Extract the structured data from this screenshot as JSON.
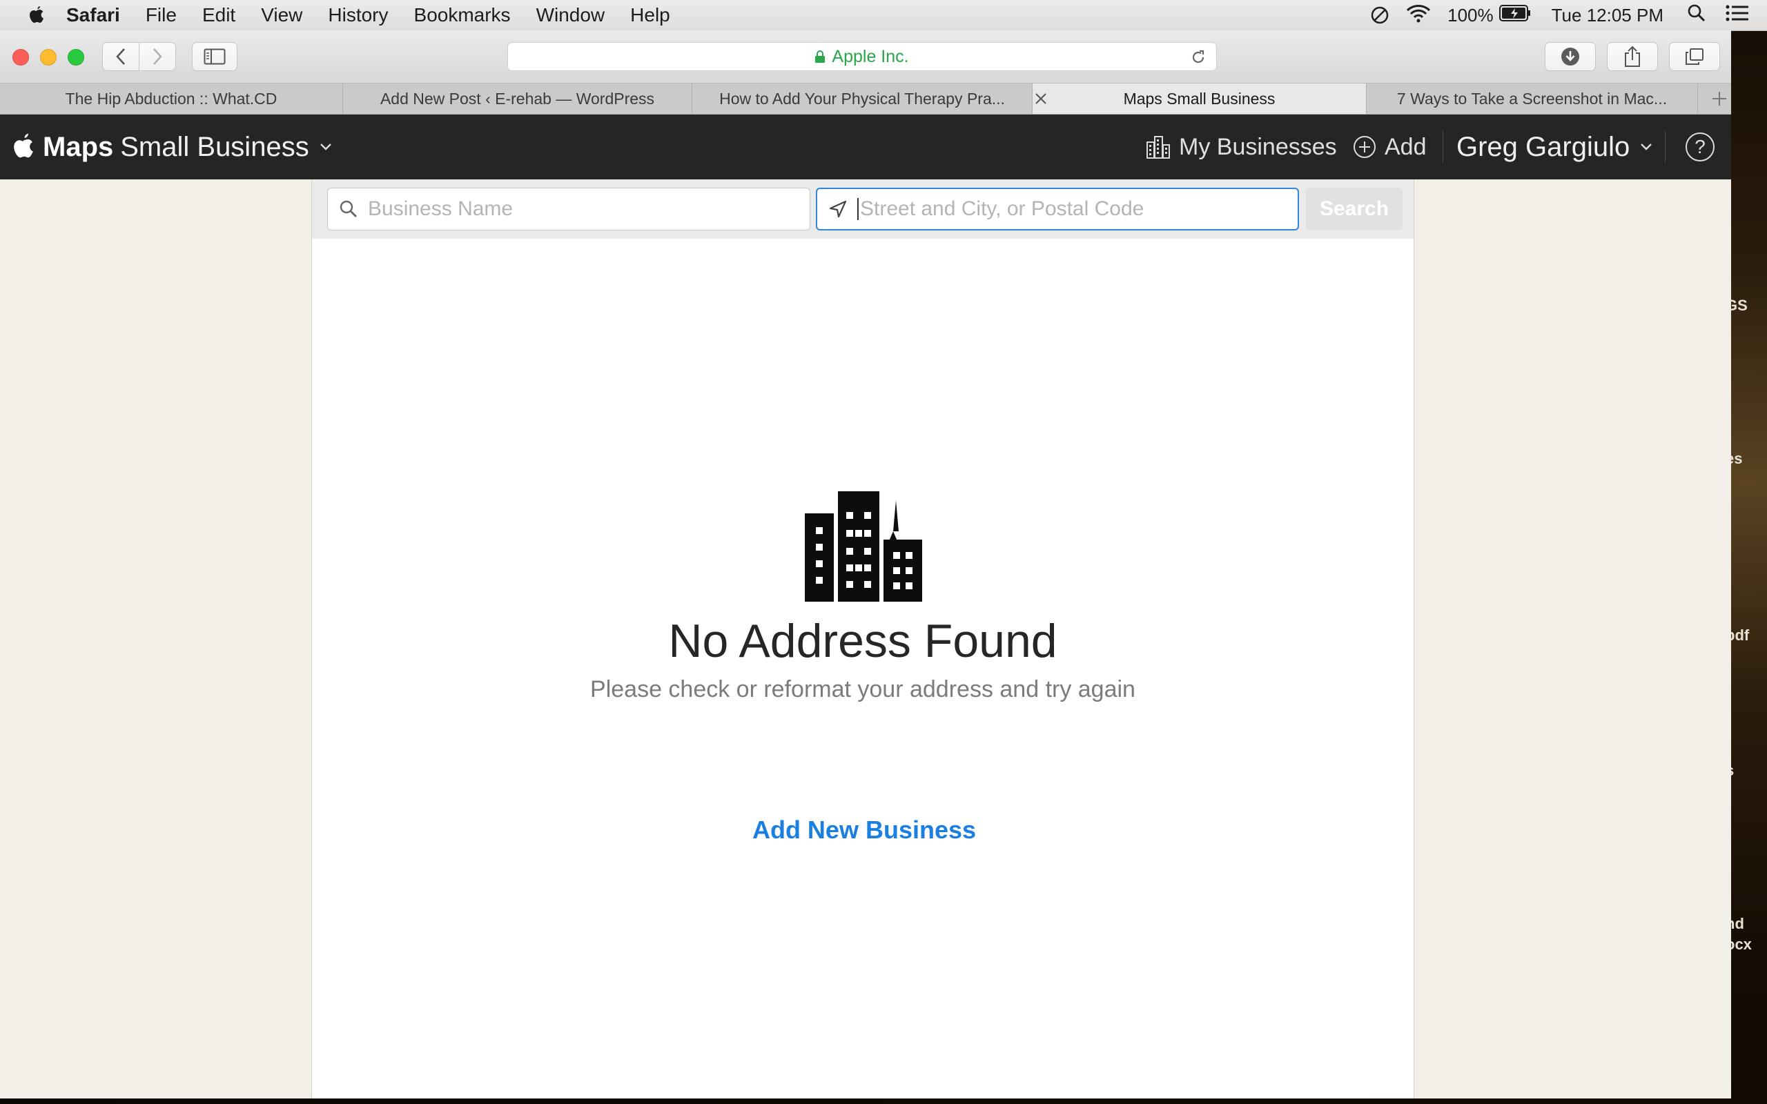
{
  "menubar": {
    "app": "Safari",
    "items": [
      "File",
      "Edit",
      "View",
      "History",
      "Bookmarks",
      "Window",
      "Help"
    ],
    "battery": "100%",
    "clock": "Tue 12:05 PM"
  },
  "browser": {
    "address": "Apple Inc.",
    "tabs": [
      "The Hip Abduction :: What.CD",
      "Add New Post ‹ E-rehab — WordPress",
      "How to Add Your Physical Therapy Pra...",
      "Maps Small Business",
      "7 Ways to Take a Screenshot in Mac..."
    ],
    "active_tab": 3
  },
  "header": {
    "brand": "Maps",
    "product": "Small Business",
    "my_businesses": "My Businesses",
    "add": "Add",
    "user": "Greg Gargiulo",
    "help": "?"
  },
  "search": {
    "business_placeholder": "Business Name",
    "address_placeholder": "Street and City, or Postal Code",
    "button": "Search"
  },
  "empty_state": {
    "title": "No Address Found",
    "subtitle": "Please check or reformat your address and try again",
    "action": "Add New Business"
  },
  "desktop": {
    "labels": [
      "GS",
      "es",
      "pdf",
      "s",
      "nd",
      "ocx"
    ]
  },
  "colors": {
    "header_bg": "#252525",
    "link_blue": "#1a7fe0",
    "focus_blue": "#2f86d8",
    "secure_green": "#2aa64a"
  }
}
